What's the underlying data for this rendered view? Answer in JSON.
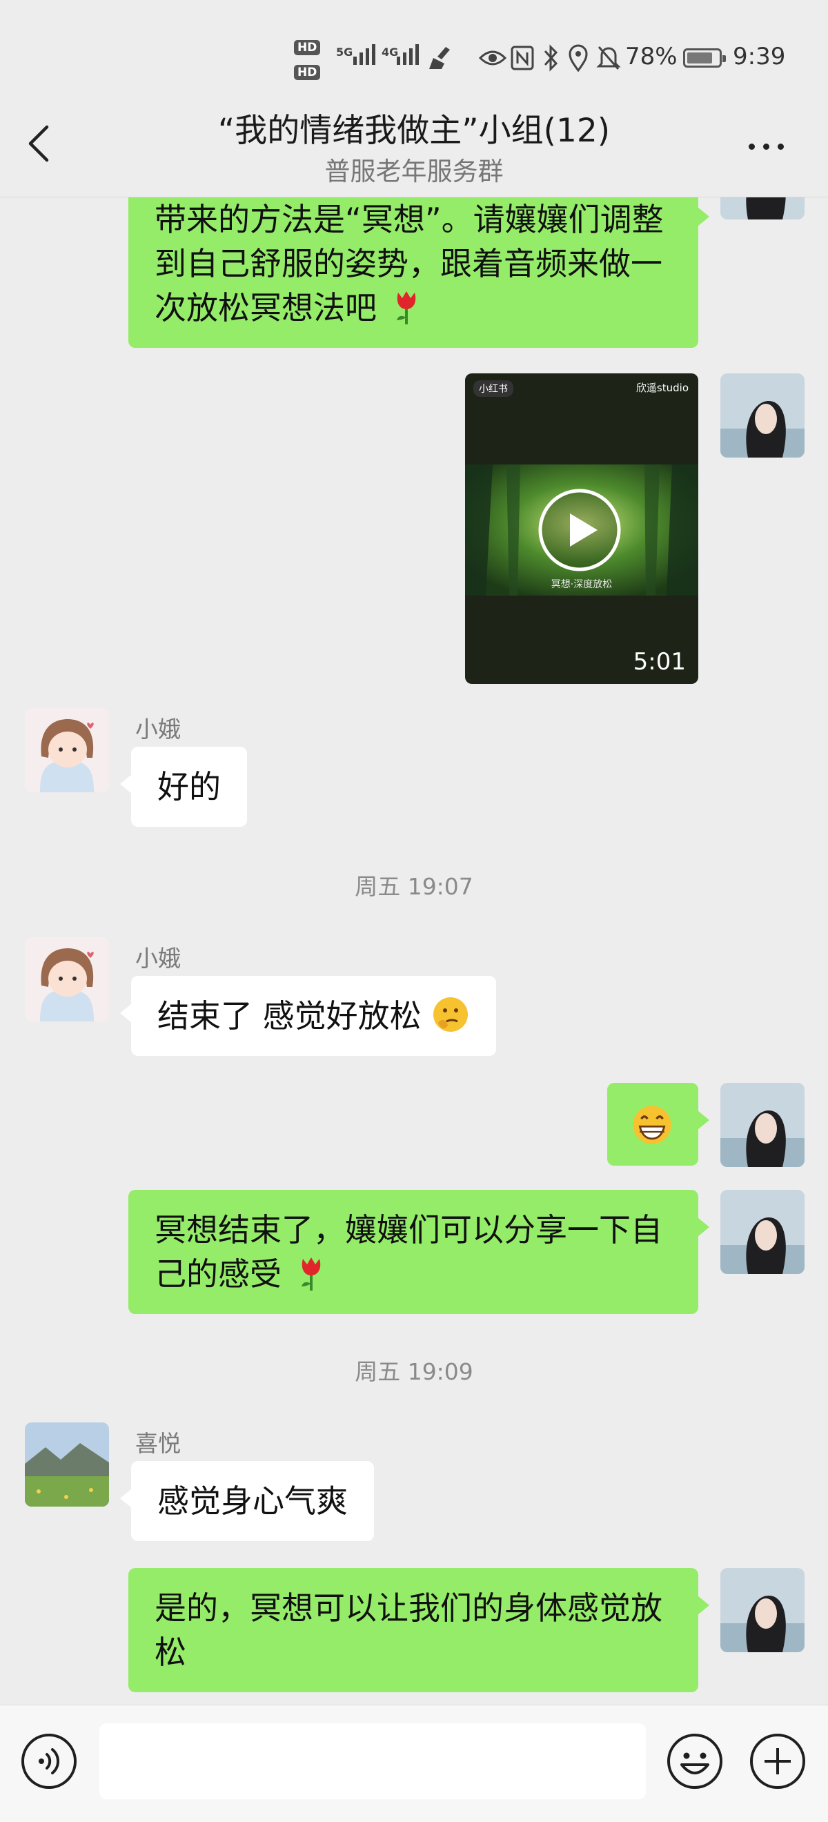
{
  "status_bar": {
    "network": "5G",
    "network2": "4G",
    "hd1": "HD",
    "hd2": "HD",
    "battery": "78%",
    "time": "9:39"
  },
  "header": {
    "title": "“我的情绪我做主”小组(12)",
    "subtitle": "普服老年服务群",
    "back_icon": "chevron-left-icon",
    "more_icon": "more-dots-icon"
  },
  "messages": [
    {
      "id": "m1",
      "side": "me",
      "type": "text",
      "text": "带来的方法是“冥想”。请孃孃们调整到自己舒服的姿势，跟着音频来做一次放松冥想法吧",
      "emoji": "tulip"
    },
    {
      "id": "m2",
      "side": "me",
      "type": "video",
      "tag": "小红书",
      "brand": "欣遥studio",
      "caption": "冥想·深度放松",
      "duration": "5:01"
    },
    {
      "id": "m3",
      "side": "other",
      "sender": "小娥",
      "type": "text",
      "text": "好的"
    },
    {
      "id": "t1",
      "type": "timestamp",
      "text": "周五 19:07"
    },
    {
      "id": "m4",
      "side": "other",
      "sender": "小娥",
      "type": "text",
      "text": "结束了 感觉好放松",
      "emoji": "thinking"
    },
    {
      "id": "m5",
      "side": "me",
      "type": "emoji",
      "emoji": "grin"
    },
    {
      "id": "m6",
      "side": "me",
      "type": "text",
      "text": "冥想结束了，孃孃们可以分享一下自己的感受",
      "emoji": "tulip"
    },
    {
      "id": "t2",
      "type": "timestamp",
      "text": "周五 19:09"
    },
    {
      "id": "m7",
      "side": "other",
      "sender": "喜悦",
      "type": "text",
      "text": "感觉身心气爽"
    },
    {
      "id": "m8",
      "side": "me",
      "type": "text",
      "text": "是的，冥想可以让我们的身体感觉放松"
    }
  ],
  "input_bar": {
    "placeholder": "",
    "voice_icon": "voice-icon",
    "emoji_icon": "emoji-icon",
    "plus_icon": "plus-icon"
  },
  "colors": {
    "me_bubble": "#95ec69",
    "other_bubble": "#ffffff",
    "background": "#ededed"
  }
}
